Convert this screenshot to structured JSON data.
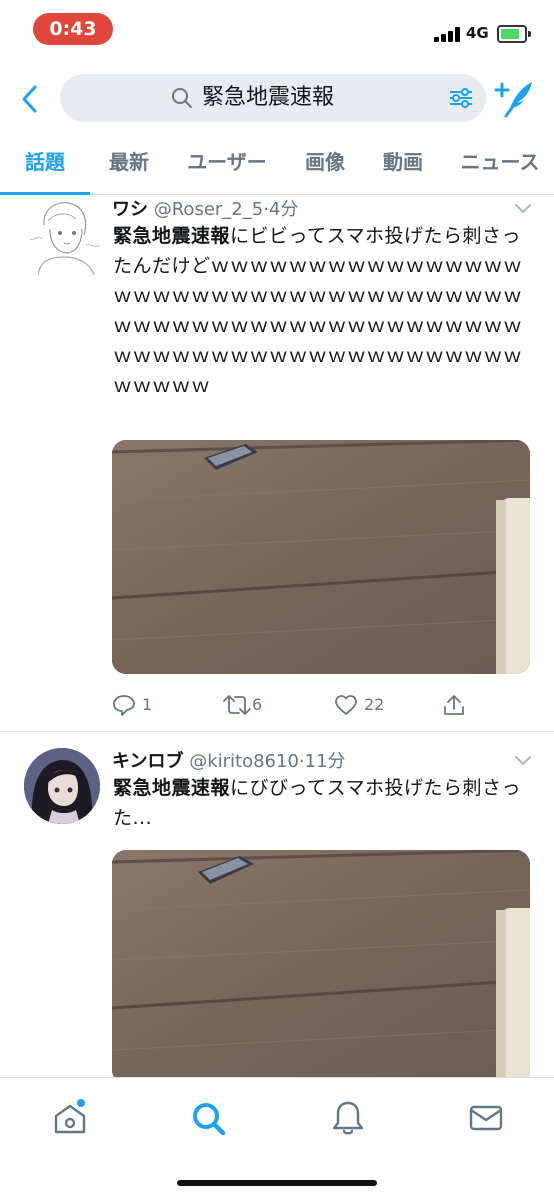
{
  "status_bar": {
    "time": "0:43",
    "network": "4G"
  },
  "header": {
    "search_query": "緊急地震速報",
    "icons": [
      "back-chevron-icon",
      "search-icon",
      "filter-sliders-icon",
      "compose-feather-icon"
    ]
  },
  "tabs": [
    {
      "label": "話題",
      "active": true
    },
    {
      "label": "最新",
      "active": false
    },
    {
      "label": "ユーザー",
      "active": false
    },
    {
      "label": "画像",
      "active": false
    },
    {
      "label": "動画",
      "active": false
    },
    {
      "label": "ニュース",
      "active": false
    }
  ],
  "tweets": [
    {
      "name": "ワシ",
      "handle": "@Roser_2_5",
      "time": "4分",
      "highlight": "緊急地震速報",
      "text": "にビビってスマホ投げたら刺さったんだけどｗｗｗｗｗｗｗｗｗｗｗｗｗｗｗｗｗｗｗｗｗｗｗｗｗｗｗｗｗｗｗｗｗｗｗｗｗｗｗｗｗｗｗｗｗｗｗｗｗｗｗｗｗｗｗｗｗｗｗｗｗｗｗｗｗｗｗｗｗｗｗｗｗｗｗｗｗｗｗｗｗｗｗｗ",
      "replies": "1",
      "retweets": "6",
      "likes": "22"
    },
    {
      "name": "キンロブ",
      "handle": "@kirito8610",
      "time": "11分",
      "highlight": "緊急地震速報",
      "text": "にびびってスマホ投げたら刺さった..."
    }
  ],
  "bottom_nav": [
    "home-icon",
    "search-icon",
    "notifications-bell-icon",
    "messages-envelope-icon"
  ],
  "colors": {
    "accent": "#1da1f2",
    "time_pill": "#e0463a",
    "secondary_text": "#657786"
  }
}
